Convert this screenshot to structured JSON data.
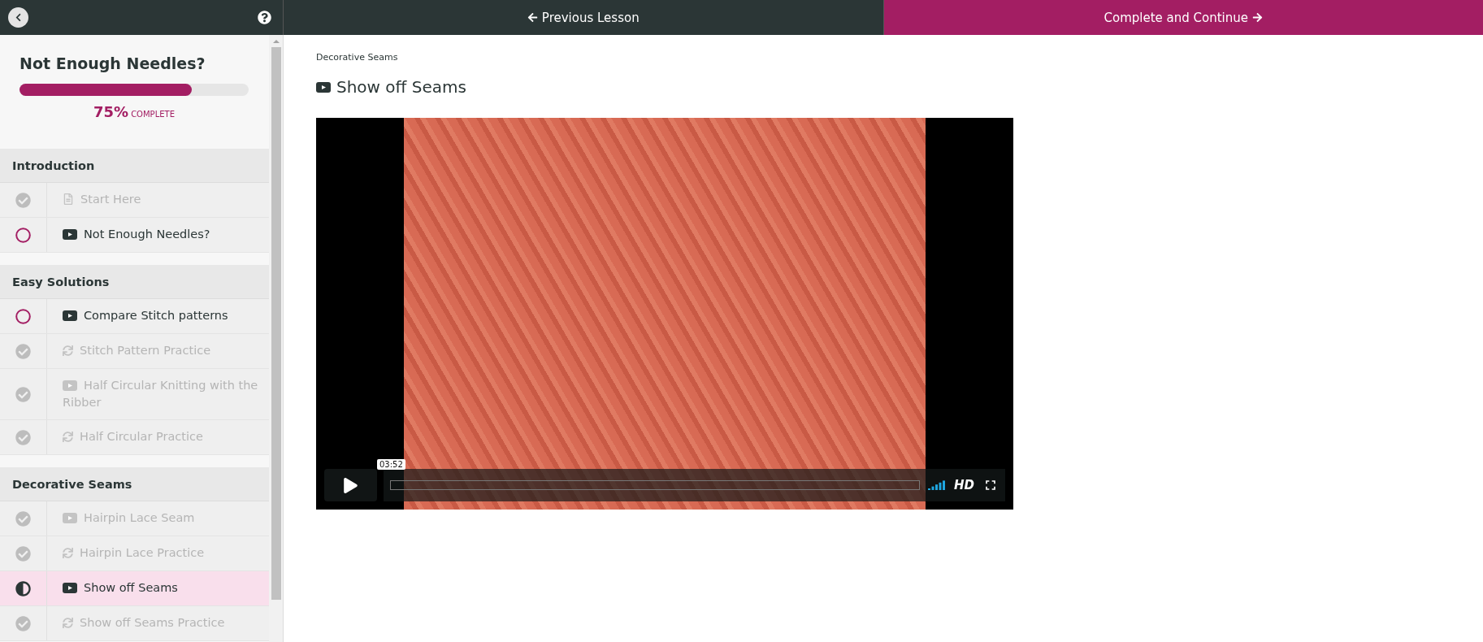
{
  "header": {
    "previous": "Previous Lesson",
    "next": "Complete and Continue"
  },
  "course": {
    "title": "Not Enough Needles?",
    "progress": {
      "level": 0.75,
      "percent": "75%",
      "label": "COMPLETE"
    }
  },
  "sections": [
    {
      "title": "Introduction",
      "lessons": [
        {
          "title": "Start Here",
          "kind": "text",
          "completed": true,
          "in_progress": false,
          "selected": false
        },
        {
          "title": "Not Enough Needles?",
          "kind": "video",
          "completed": false,
          "in_progress": false,
          "selected": false
        }
      ]
    },
    {
      "title": "Easy Solutions",
      "lessons": [
        {
          "title": "Compare Stitch patterns",
          "kind": "video",
          "completed": false,
          "in_progress": false,
          "selected": false
        },
        {
          "title": "Stitch Pattern Practice",
          "kind": "quiz",
          "completed": true,
          "in_progress": false,
          "selected": false
        },
        {
          "title": "Half Circular Knitting with the Ribber",
          "kind": "video",
          "completed": true,
          "in_progress": false,
          "selected": false
        },
        {
          "title": "Half Circular Practice",
          "kind": "quiz",
          "completed": true,
          "in_progress": false,
          "selected": false
        }
      ]
    },
    {
      "title": "Decorative Seams",
      "lessons": [
        {
          "title": "Hairpin Lace Seam",
          "kind": "video",
          "completed": true,
          "in_progress": false,
          "selected": false
        },
        {
          "title": "Hairpin Lace Practice",
          "kind": "quiz",
          "completed": true,
          "in_progress": false,
          "selected": false
        },
        {
          "title": "Show off Seams",
          "kind": "video",
          "completed": false,
          "in_progress": true,
          "selected": true
        },
        {
          "title": "Show off Seams Practice",
          "kind": "quiz",
          "completed": true,
          "in_progress": false,
          "selected": false
        }
      ]
    }
  ],
  "lesson": {
    "breadcrumb": "Decorative Seams",
    "title": "Show off Seams",
    "kind": "video"
  },
  "player": {
    "time": "03:52",
    "quality": "HD"
  }
}
